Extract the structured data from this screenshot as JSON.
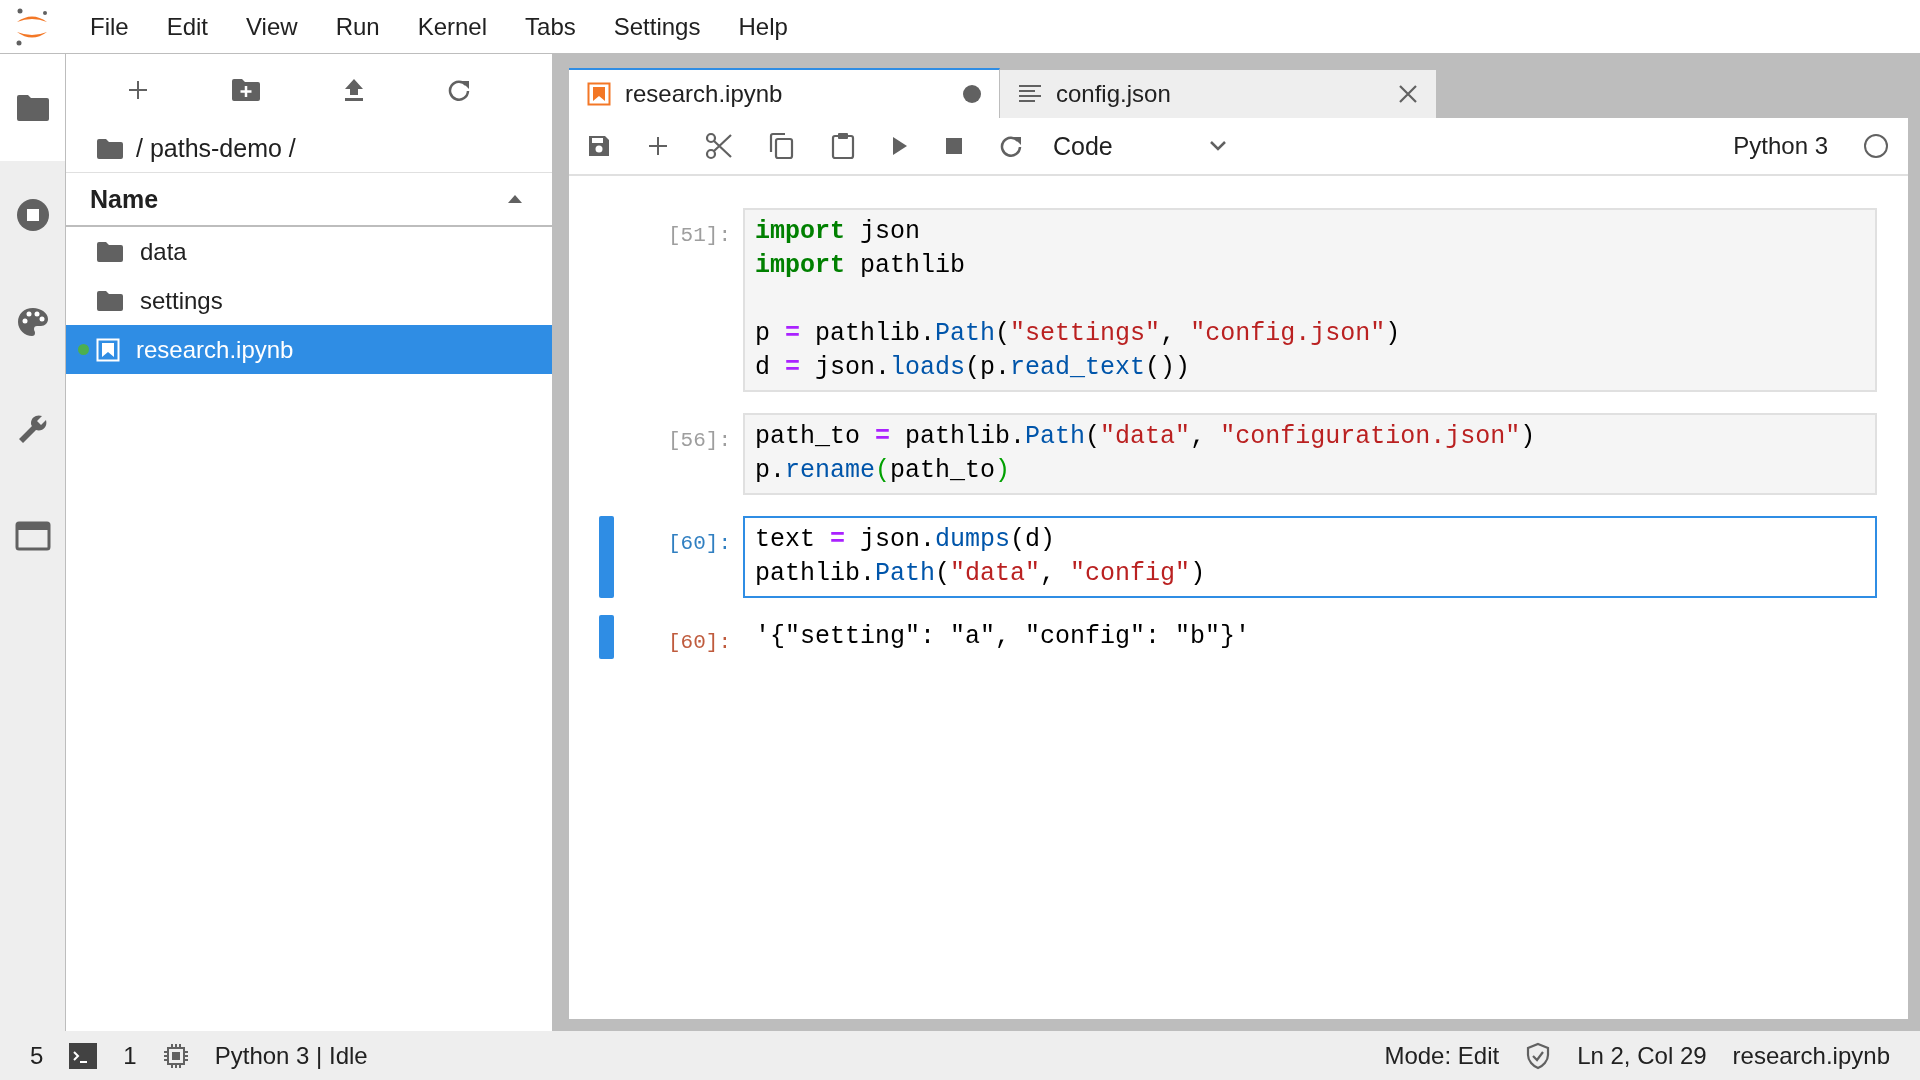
{
  "menu_bar": {
    "items": [
      "File",
      "Edit",
      "View",
      "Run",
      "Kernel",
      "Tabs",
      "Settings",
      "Help"
    ]
  },
  "activity_bar": {
    "items": [
      {
        "kind": "files",
        "selected": true
      },
      {
        "kind": "running",
        "selected": false
      },
      {
        "kind": "palette",
        "selected": false
      },
      {
        "kind": "tools",
        "selected": false
      },
      {
        "kind": "tabs",
        "selected": false
      }
    ]
  },
  "file_browser": {
    "path": "/ paths-demo /",
    "column": "Name",
    "items": [
      {
        "name": "data",
        "kind": "folder",
        "selected": false,
        "running": false
      },
      {
        "name": "settings",
        "kind": "folder",
        "selected": false,
        "running": false
      },
      {
        "name": "research.ipynb",
        "kind": "notebook",
        "selected": true,
        "running": true
      }
    ]
  },
  "tabs": [
    {
      "label": "research.ipynb",
      "kind": "notebook",
      "selected": true,
      "modified": true
    },
    {
      "label": "config.json",
      "kind": "json",
      "selected": false,
      "modified": false
    }
  ],
  "toolbar": {
    "cell_type": "Code",
    "kernel": "Python 3",
    "kernel_busy": false
  },
  "cells": [
    {
      "kind": "input",
      "prompt": "[51]:",
      "active": false,
      "editing": false,
      "lines": [
        {
          "kind": "code",
          "tokens": [
            {
              "kind": "keyword",
              "s": "import"
            },
            {
              "kind": "plain",
              "s": " json"
            }
          ]
        },
        {
          "kind": "code",
          "tokens": [
            {
              "kind": "keyword",
              "s": "import"
            },
            {
              "kind": "plain",
              "s": " pathlib"
            }
          ]
        },
        {
          "kind": "blank"
        },
        {
          "kind": "code",
          "tokens": [
            {
              "kind": "plain",
              "s": "p "
            },
            {
              "kind": "operator",
              "s": "="
            },
            {
              "kind": "plain",
              "s": " pathlib."
            },
            {
              "kind": "property",
              "s": "Path"
            },
            {
              "kind": "plain",
              "s": "("
            },
            {
              "kind": "string",
              "s": "\"settings\""
            },
            {
              "kind": "plain",
              "s": ", "
            },
            {
              "kind": "string",
              "s": "\"config.json\""
            },
            {
              "kind": "plain",
              "s": ")"
            }
          ]
        },
        {
          "kind": "code",
          "tokens": [
            {
              "kind": "plain",
              "s": "d "
            },
            {
              "kind": "operator",
              "s": "="
            },
            {
              "kind": "plain",
              "s": " json."
            },
            {
              "kind": "property",
              "s": "loads"
            },
            {
              "kind": "plain",
              "s": "(p."
            },
            {
              "kind": "property",
              "s": "read_text"
            },
            {
              "kind": "plain",
              "s": "())"
            }
          ]
        }
      ]
    },
    {
      "kind": "input",
      "prompt": "[56]:",
      "active": false,
      "editing": false,
      "lines": [
        {
          "kind": "code",
          "tokens": [
            {
              "kind": "plain",
              "s": "path_to "
            },
            {
              "kind": "operator",
              "s": "="
            },
            {
              "kind": "plain",
              "s": " pathlib."
            },
            {
              "kind": "property",
              "s": "Path"
            },
            {
              "kind": "plain",
              "s": "("
            },
            {
              "kind": "string",
              "s": "\"data\""
            },
            {
              "kind": "plain",
              "s": ", "
            },
            {
              "kind": "string",
              "s": "\"configuration.json\""
            },
            {
              "kind": "plain",
              "s": ")"
            }
          ]
        },
        {
          "kind": "code",
          "tokens": [
            {
              "kind": "plain",
              "s": "p."
            },
            {
              "kind": "property",
              "s": "rename"
            },
            {
              "kind": "bracket",
              "s": "("
            },
            {
              "kind": "plain",
              "s": "path_to"
            },
            {
              "kind": "bracket",
              "s": ")"
            }
          ]
        }
      ]
    },
    {
      "kind": "input",
      "prompt": "[60]:",
      "active": true,
      "editing": true,
      "lines": [
        {
          "kind": "code",
          "tokens": [
            {
              "kind": "plain",
              "s": "text "
            },
            {
              "kind": "operator",
              "s": "="
            },
            {
              "kind": "plain",
              "s": " json."
            },
            {
              "kind": "property",
              "s": "dumps"
            },
            {
              "kind": "plain",
              "s": "(d)"
            }
          ]
        },
        {
          "kind": "code",
          "tokens": [
            {
              "kind": "plain",
              "s": "pathlib."
            },
            {
              "kind": "property",
              "s": "Path"
            },
            {
              "kind": "plain",
              "s": "("
            },
            {
              "kind": "string",
              "s": "\"data\""
            },
            {
              "kind": "plain",
              "s": ", "
            },
            {
              "kind": "string",
              "s": "\"config\""
            },
            {
              "kind": "plain",
              "s": ")"
            }
          ]
        }
      ]
    },
    {
      "kind": "output",
      "prompt": "[60]:",
      "active": true,
      "lines": [
        {
          "kind": "code",
          "tokens": [
            {
              "kind": "plain",
              "s": "'{\"setting\": \"a\", \"config\": \"b\"}'"
            }
          ]
        }
      ]
    }
  ],
  "status_bar": {
    "left": [
      {
        "kind": "text",
        "text": "5"
      },
      {
        "kind": "terminal"
      },
      {
        "kind": "text",
        "text": "1"
      },
      {
        "kind": "chip"
      },
      {
        "kind": "text",
        "text": "Python 3 | Idle"
      }
    ],
    "right": [
      {
        "kind": "text",
        "text": "Mode: Edit"
      },
      {
        "kind": "shield"
      },
      {
        "kind": "text",
        "text": "Ln 2, Col 29"
      },
      {
        "kind": "text",
        "text": "research.ipynb"
      }
    ]
  }
}
